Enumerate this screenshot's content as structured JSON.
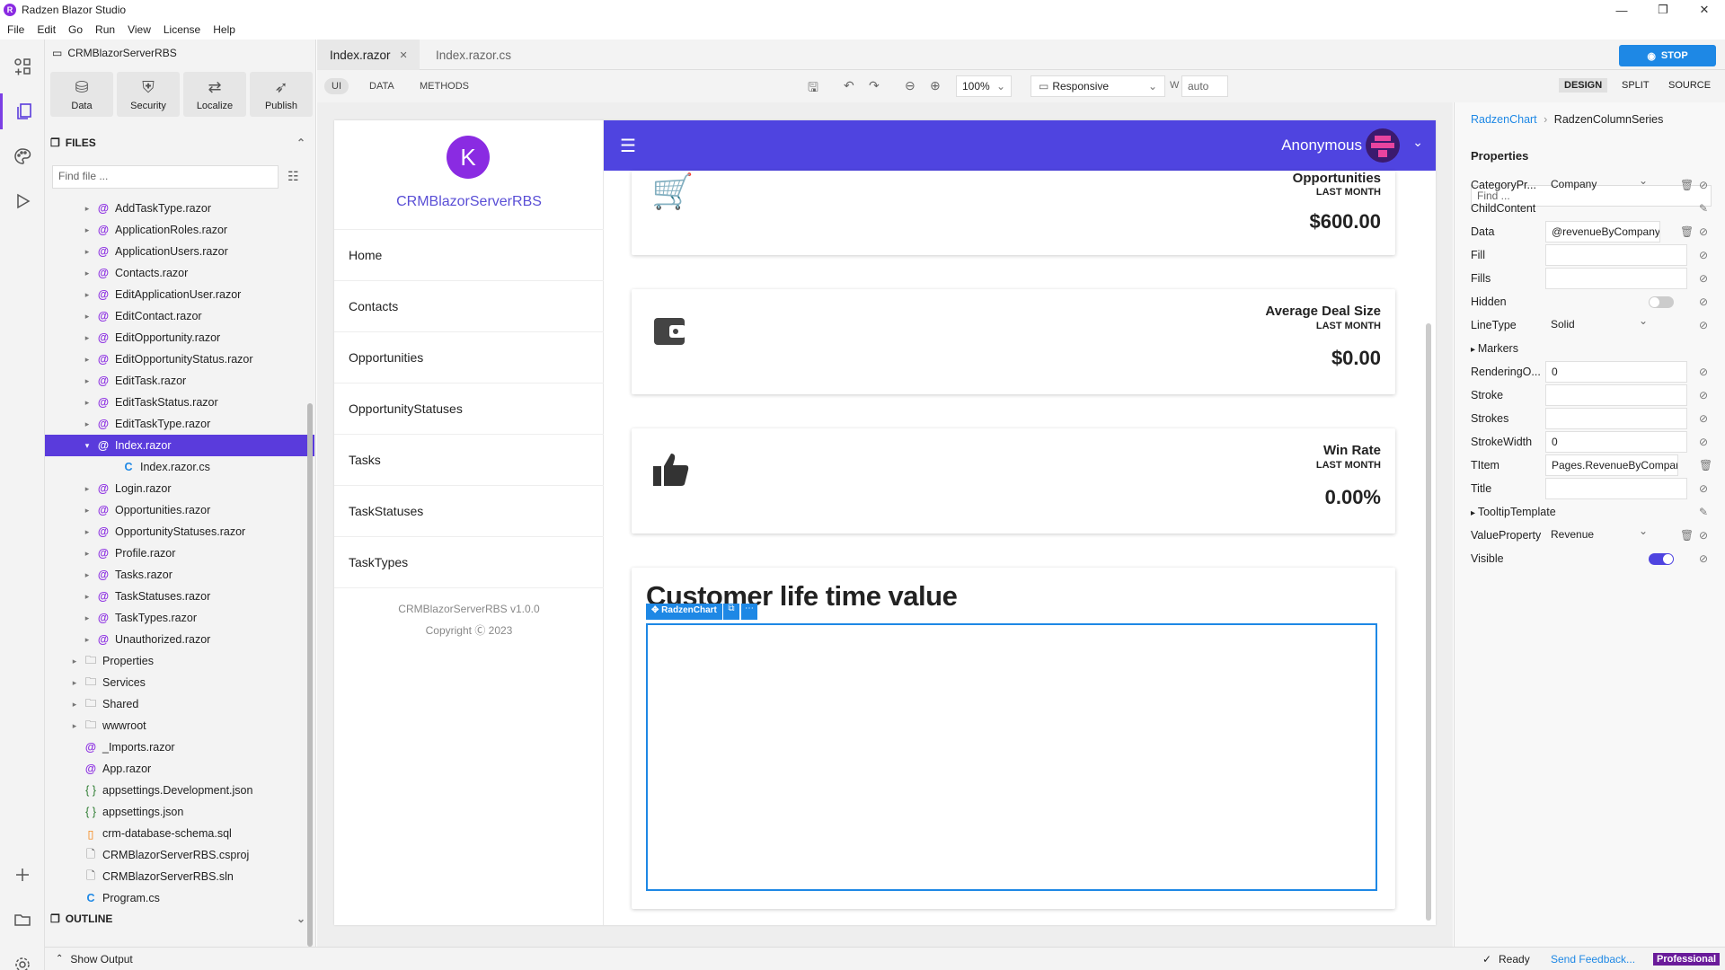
{
  "window": {
    "title": "Radzen Blazor Studio",
    "minimize": "—",
    "maximize": "❐",
    "close": "✕"
  },
  "menu": [
    "File",
    "Edit",
    "Go",
    "Run",
    "View",
    "License",
    "Help"
  ],
  "explorer": {
    "project": "CRMBlazorServerRBS",
    "tools": [
      {
        "label": "Data",
        "icon": "database-icon"
      },
      {
        "label": "Security",
        "icon": "shield-icon"
      },
      {
        "label": "Localize",
        "icon": "translate-icon"
      },
      {
        "label": "Publish",
        "icon": "rocket-icon"
      }
    ],
    "files_header": "FILES",
    "find_placeholder": "Find file ...",
    "tree": [
      {
        "name": "AddTaskType.razor",
        "kind": "razor",
        "level": 2
      },
      {
        "name": "ApplicationRoles.razor",
        "kind": "razor",
        "level": 2
      },
      {
        "name": "ApplicationUsers.razor",
        "kind": "razor",
        "level": 2
      },
      {
        "name": "Contacts.razor",
        "kind": "razor",
        "level": 2
      },
      {
        "name": "EditApplicationUser.razor",
        "kind": "razor",
        "level": 2
      },
      {
        "name": "EditContact.razor",
        "kind": "razor",
        "level": 2
      },
      {
        "name": "EditOpportunity.razor",
        "kind": "razor",
        "level": 2
      },
      {
        "name": "EditOpportunityStatus.razor",
        "kind": "razor",
        "level": 2
      },
      {
        "name": "EditTask.razor",
        "kind": "razor",
        "level": 2
      },
      {
        "name": "EditTaskStatus.razor",
        "kind": "razor",
        "level": 2
      },
      {
        "name": "EditTaskType.razor",
        "kind": "razor",
        "level": 2
      },
      {
        "name": "Index.razor",
        "kind": "razor",
        "level": 2,
        "selected": true,
        "expanded": true
      },
      {
        "name": "Index.razor.cs",
        "kind": "cs",
        "level": 3
      },
      {
        "name": "Login.razor",
        "kind": "razor",
        "level": 2
      },
      {
        "name": "Opportunities.razor",
        "kind": "razor",
        "level": 2
      },
      {
        "name": "OpportunityStatuses.razor",
        "kind": "razor",
        "level": 2
      },
      {
        "name": "Profile.razor",
        "kind": "razor",
        "level": 2
      },
      {
        "name": "Tasks.razor",
        "kind": "razor",
        "level": 2
      },
      {
        "name": "TaskStatuses.razor",
        "kind": "razor",
        "level": 2
      },
      {
        "name": "TaskTypes.razor",
        "kind": "razor",
        "level": 2
      },
      {
        "name": "Unauthorized.razor",
        "kind": "razor",
        "level": 2
      },
      {
        "name": "Properties",
        "kind": "folder",
        "level": 1
      },
      {
        "name": "Services",
        "kind": "folder",
        "level": 1
      },
      {
        "name": "Shared",
        "kind": "folder",
        "level": 1
      },
      {
        "name": "wwwroot",
        "kind": "folder",
        "level": 1
      },
      {
        "name": "_Imports.razor",
        "kind": "razor",
        "level": 1
      },
      {
        "name": "App.razor",
        "kind": "razor",
        "level": 1
      },
      {
        "name": "appsettings.Development.json",
        "kind": "json",
        "level": 1
      },
      {
        "name": "appsettings.json",
        "kind": "json",
        "level": 1
      },
      {
        "name": "crm-database-schema.sql",
        "kind": "sql",
        "level": 1
      },
      {
        "name": "CRMBlazorServerRBS.csproj",
        "kind": "file",
        "level": 1
      },
      {
        "name": "CRMBlazorServerRBS.sln",
        "kind": "file",
        "level": 1
      },
      {
        "name": "Program.cs",
        "kind": "cs",
        "level": 1
      }
    ],
    "outline": "OUTLINE"
  },
  "status": {
    "show_output": "Show Output",
    "ready": "Ready",
    "feedback": "Send Feedback...",
    "edition": "Professional"
  },
  "tabs": [
    {
      "label": "Index.razor",
      "active": true,
      "close": "✕"
    },
    {
      "label": "Index.razor.cs",
      "active": false
    }
  ],
  "stop_label": "STOP",
  "designer": {
    "modes_left": [
      "UI",
      "DATA",
      "METHODS"
    ],
    "zoom": "100%",
    "device": "Responsive",
    "width_label": "W",
    "width_value": "auto",
    "modes_right": [
      "DESIGN",
      "SPLIT",
      "SOURCE"
    ]
  },
  "app": {
    "name": "CRMBlazorServerRBS",
    "logo_letter": "K",
    "nav": [
      "Home",
      "Contacts",
      "Opportunities",
      "OpportunityStatuses",
      "Tasks",
      "TaskStatuses",
      "TaskTypes"
    ],
    "version": "CRMBlazorServerRBS v1.0.0",
    "copyright": "Copyright Ⓒ 2023",
    "user": "Anonymous",
    "cards": [
      {
        "title": "Opportunities",
        "subtitle": "LAST MONTH",
        "value": "$600.00",
        "icon": "cart-icon"
      },
      {
        "title": "Average Deal Size",
        "subtitle": "LAST MONTH",
        "value": "$0.00",
        "icon": "wallet-icon"
      },
      {
        "title": "Win Rate",
        "subtitle": "LAST MONTH",
        "value": "0.00%",
        "icon": "thumbs-up-icon"
      }
    ],
    "chart_heading": "Customer life time value",
    "chart_badge": "RadzenChart"
  },
  "properties": {
    "breadcrumb": [
      "RadzenChart",
      "RadzenColumnSeries"
    ],
    "header": "Properties",
    "find_placeholder": "Find ...",
    "rows": [
      {
        "label": "CategoryPr...",
        "value": "Company",
        "type": "select",
        "del": true
      },
      {
        "label": "ChildContent",
        "value": "",
        "type": "edit"
      },
      {
        "label": "Data",
        "value": "@revenueByCompany",
        "type": "text",
        "del": true
      },
      {
        "label": "Fill",
        "value": "",
        "type": "text"
      },
      {
        "label": "Fills",
        "value": "",
        "type": "text"
      },
      {
        "label": "Hidden",
        "value": "",
        "type": "toggle",
        "on": false
      },
      {
        "label": "LineType",
        "value": "Solid",
        "type": "select"
      },
      {
        "label": "Markers",
        "value": "",
        "type": "group"
      },
      {
        "label": "RenderingO...",
        "value": "0",
        "type": "text"
      },
      {
        "label": "Stroke",
        "value": "",
        "type": "text"
      },
      {
        "label": "Strokes",
        "value": "",
        "type": "text"
      },
      {
        "label": "StrokeWidth",
        "value": "0",
        "type": "text"
      },
      {
        "label": "TItem",
        "value": "Pages.RevenueByCompany",
        "type": "text",
        "del": true
      },
      {
        "label": "Title",
        "value": "",
        "type": "text"
      },
      {
        "label": "TooltipTemplate",
        "value": "",
        "type": "group-edit"
      },
      {
        "label": "ValueProperty",
        "value": "Revenue",
        "type": "select",
        "del": true
      },
      {
        "label": "Visible",
        "value": "",
        "type": "toggle",
        "on": true
      }
    ]
  }
}
